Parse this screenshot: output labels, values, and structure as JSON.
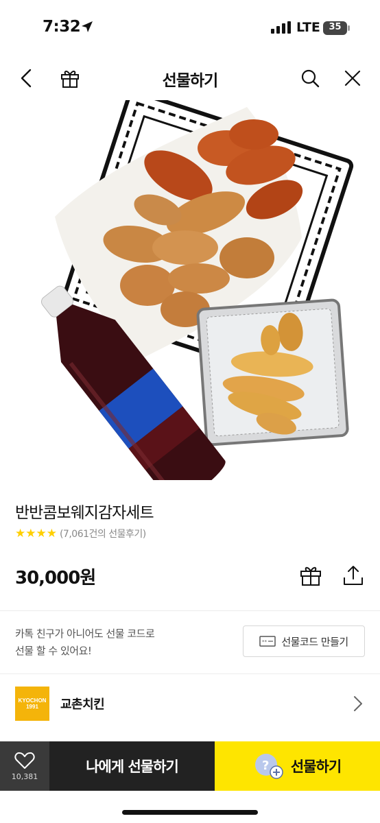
{
  "status_bar": {
    "time": "7:32",
    "network": "LTE",
    "battery": "35"
  },
  "nav": {
    "title": "선물하기"
  },
  "product": {
    "name": "반반콤보웨지감자세트",
    "stars": "★★★★",
    "review_count": "(7,061건의 선물후기)",
    "price": "30,000원"
  },
  "gift_code": {
    "description_line1": "카톡 친구가 아니어도 선물 코드로",
    "description_line2": "선물 할 수 있어요!",
    "button_label": "선물코드 만들기"
  },
  "brand": {
    "logo_line1": "KYOCHON",
    "logo_line2": "1991",
    "name": "교촌치킨"
  },
  "bottom_bar": {
    "like_count": "10,381",
    "gift_self_label": "나에게 선물하기",
    "gift_label": "선물하기"
  },
  "colors": {
    "accent": "#fee500",
    "star": "#ffcf00",
    "brand": "#f4b40a"
  }
}
